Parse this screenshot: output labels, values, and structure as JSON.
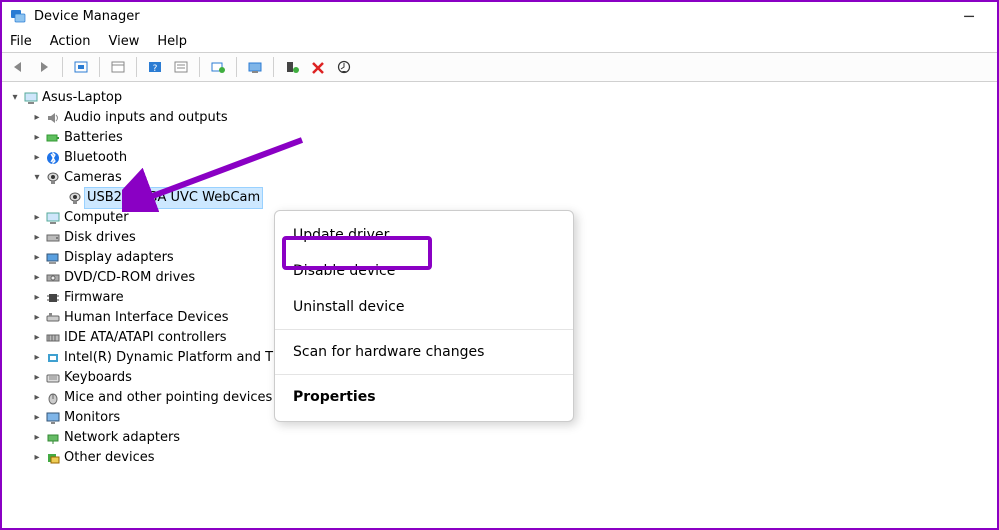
{
  "window": {
    "title": "Device Manager"
  },
  "menu": {
    "file": "File",
    "action": "Action",
    "view": "View",
    "help": "Help"
  },
  "root": "Asus-Laptop",
  "categories": [
    {
      "label": "Audio inputs and outputs"
    },
    {
      "label": "Batteries"
    },
    {
      "label": "Bluetooth"
    },
    {
      "label": "Cameras",
      "expanded": true,
      "child": "USB2.0 VGA UVC WebCam"
    },
    {
      "label": "Computer"
    },
    {
      "label": "Disk drives"
    },
    {
      "label": "Display adapters"
    },
    {
      "label": "DVD/CD-ROM drives"
    },
    {
      "label": "Firmware"
    },
    {
      "label": "Human Interface Devices"
    },
    {
      "label": "IDE ATA/ATAPI controllers"
    },
    {
      "label": "Intel(R) Dynamic Platform and Thermal Framework"
    },
    {
      "label": "Keyboards"
    },
    {
      "label": "Mice and other pointing devices"
    },
    {
      "label": "Monitors"
    },
    {
      "label": "Network adapters"
    },
    {
      "label": "Other devices"
    }
  ],
  "context_menu": {
    "update": "Update driver",
    "disable": "Disable device",
    "uninstall": "Uninstall device",
    "scan": "Scan for hardware changes",
    "properties": "Properties"
  }
}
